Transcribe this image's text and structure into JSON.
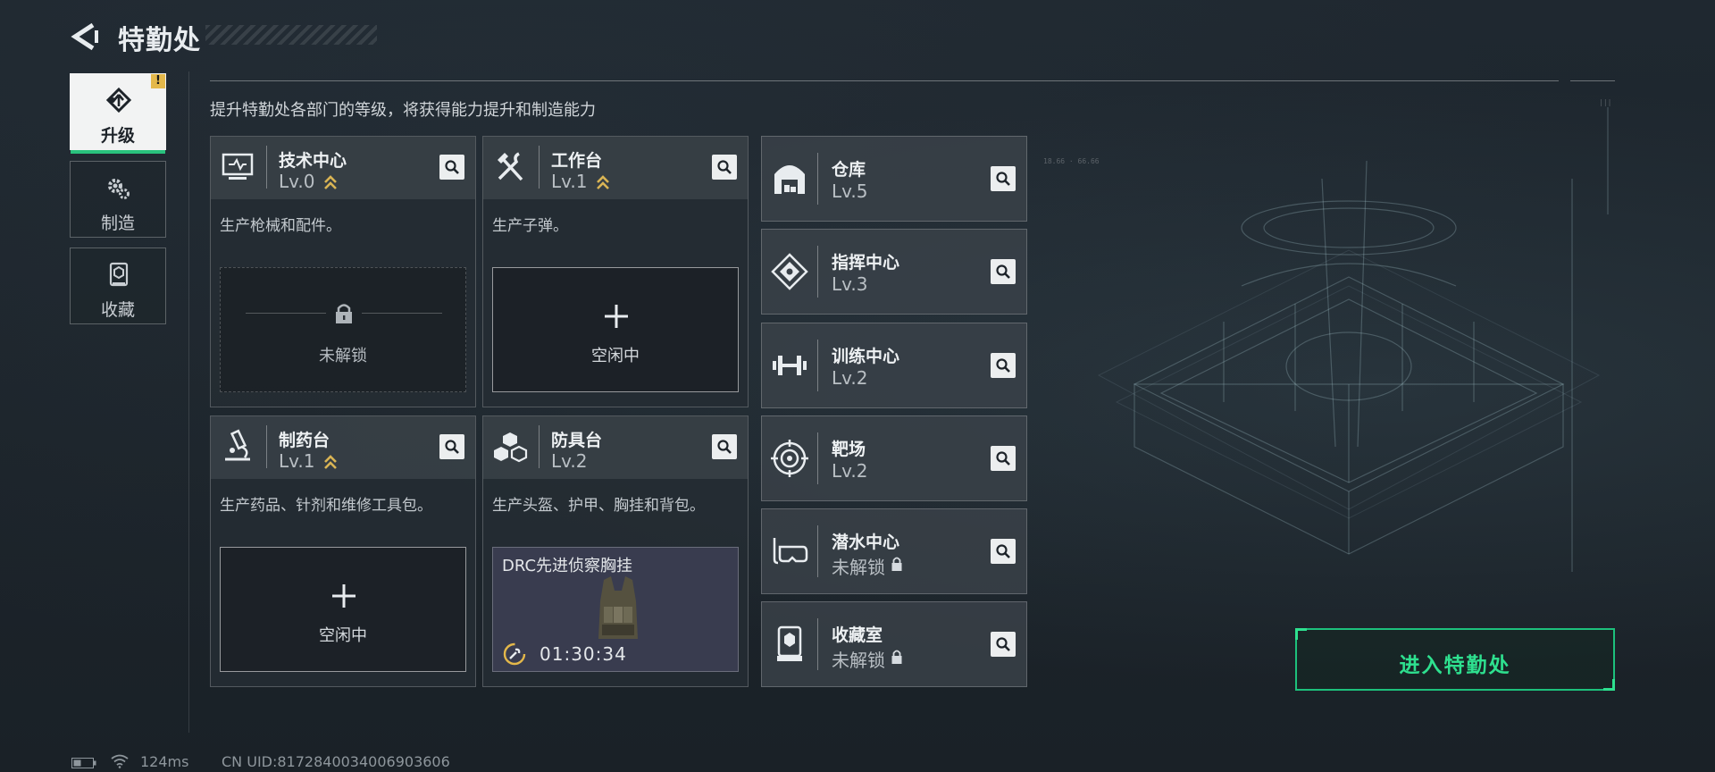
{
  "header": {
    "title": "特勤处"
  },
  "sidebar": {
    "items": [
      {
        "label": "升级",
        "active": true,
        "alert": "!"
      },
      {
        "label": "制造",
        "active": false
      },
      {
        "label": "收藏",
        "active": false
      }
    ]
  },
  "description": "提升特勤处各部门的等级，将获得能力提升和制造能力",
  "facilities": [
    {
      "name": "技术中心",
      "level": "Lv.0",
      "upgradable": true,
      "desc": "生产枪械和配件。",
      "slot": {
        "state": "locked",
        "label": "未解锁"
      }
    },
    {
      "name": "工作台",
      "level": "Lv.1",
      "upgradable": true,
      "desc": "生产子弹。",
      "slot": {
        "state": "idle",
        "label": "空闲中"
      }
    },
    {
      "name": "制药台",
      "level": "Lv.1",
      "upgradable": true,
      "desc": "生产药品、针剂和维修工具包。",
      "slot": {
        "state": "idle",
        "label": "空闲中"
      }
    },
    {
      "name": "防具台",
      "level": "Lv.2",
      "upgradable": false,
      "desc": "生产头盔、护甲、胸挂和背包。",
      "slot": {
        "state": "crafting",
        "item": "DRC先进侦察胸挂",
        "timer": "01:30:34"
      }
    }
  ],
  "rooms": [
    {
      "name": "仓库",
      "level": "Lv.5",
      "locked": false
    },
    {
      "name": "指挥中心",
      "level": "Lv.3",
      "locked": false
    },
    {
      "name": "训练中心",
      "level": "Lv.2",
      "locked": false
    },
    {
      "name": "靶场",
      "level": "Lv.2",
      "locked": false
    },
    {
      "name": "潜水中心",
      "level": "未解锁",
      "locked": true
    },
    {
      "name": "收藏室",
      "level": "未解锁",
      "locked": true
    }
  ],
  "enter_button": "进入特勤处",
  "status": {
    "ping": "124ms",
    "uid": "CN UID:8172840034006903606"
  },
  "colors": {
    "accent_green": "#2ee08f",
    "upgrade_gold": "#d9b454",
    "alert_yellow": "#e4b84a"
  }
}
